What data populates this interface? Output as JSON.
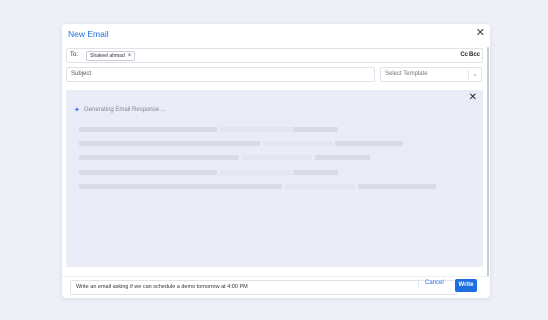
{
  "modal": {
    "title": "New Email",
    "close_glyph": "✕"
  },
  "to": {
    "label": "To:",
    "recipient": "Shakeel ahmad",
    "chip_remove_glyph": "×",
    "cc_label": "Cc",
    "bcc_label": "Bcc"
  },
  "subject": {
    "placeholder": "Subject"
  },
  "template": {
    "placeholder": "Select Template",
    "chevron_glyph": "⌄"
  },
  "generation": {
    "sparkle_glyph": "✦",
    "status_text": "Generating Email Response ...",
    "close_glyph": "✕"
  },
  "prompt_bar": {
    "value": "Write an email asking if we can schedule a demo tomorrow at 4:00 PM",
    "cancel_label": "Cancel",
    "write_label": "Write"
  },
  "colors": {
    "accent": "#1d6fe0",
    "panel_bg": "#e9ecf7",
    "page_bg": "#eef0f7"
  }
}
